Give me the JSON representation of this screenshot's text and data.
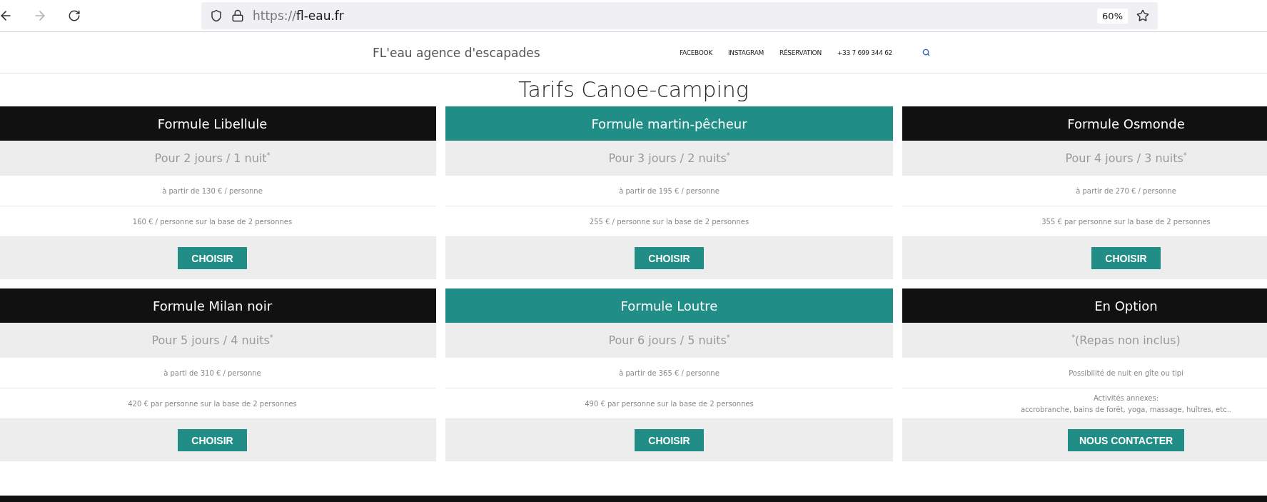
{
  "browser": {
    "forward": {
      "disabled": true
    },
    "url_scheme": "https://",
    "url_host": "fl-eau.fr",
    "zoom": "60%"
  },
  "header": {
    "brand": "FL'eau agence d'escapades",
    "nav": [
      "FACEBOOK",
      "INSTAGRAM",
      "RÉSERVATION",
      "+33 7 699 344 62"
    ]
  },
  "page_title": "Tarifs Canoe-camping",
  "cards": [
    {
      "title": "Formule Libellule",
      "color": "#111111",
      "subtitle": "Pour 2 jours / 1 nuit$^{*}$",
      "rows": [
        [
          "à partir de 130 € / personne"
        ],
        [
          "160 € / personne sur la base de 2 personnes"
        ]
      ],
      "button": "CHOISIR"
    },
    {
      "title": "Formule martin-pêcheur",
      "color": "#208d87",
      "subtitle": "Pour 3 jours / 2 nuits$^{*}$",
      "rows": [
        [
          "à partir de 195 € / personne"
        ],
        [
          "255 € / personne sur la base de 2 personnes"
        ]
      ],
      "button": "CHOISIR"
    },
    {
      "title": "Formule Osmonde",
      "color": "#111111",
      "subtitle": "Pour 4 jours / 3 nuits$^{*}$",
      "rows": [
        [
          "à partir de 270 € / personne"
        ],
        [
          "355 € par personne sur la base de 2 personnes"
        ]
      ],
      "button": "CHOISIR"
    },
    {
      "title": "Formule Milan noir",
      "color": "#111111",
      "subtitle": "Pour 5 jours / 4 nuits$^{*}$",
      "rows": [
        [
          "à parti de 310 € / personne"
        ],
        [
          "420 € par personne sur la base de 2 personnes"
        ]
      ],
      "button": "CHOISIR"
    },
    {
      "title": "Formule Loutre",
      "color": "#208d87",
      "subtitle": "Pour 6 jours / 5 nuits$^{*}$",
      "rows": [
        [
          "à partir de 365 € / personne"
        ],
        [
          "490 € par personne sur la base de 2 personnes"
        ]
      ],
      "button": "CHOISIR"
    },
    {
      "title": "En Option",
      "color": "#111111",
      "subtitle": "$^{*}$(Repas non inclus)",
      "rows": [
        [
          "Possibilité de nuit en gîte ou tipi"
        ],
        [
          "Activités annexes:",
          "accrobranche, bains de forêt, yoga, massage, huîtres, etc.."
        ]
      ],
      "button": "NOUS CONTACTER"
    }
  ]
}
